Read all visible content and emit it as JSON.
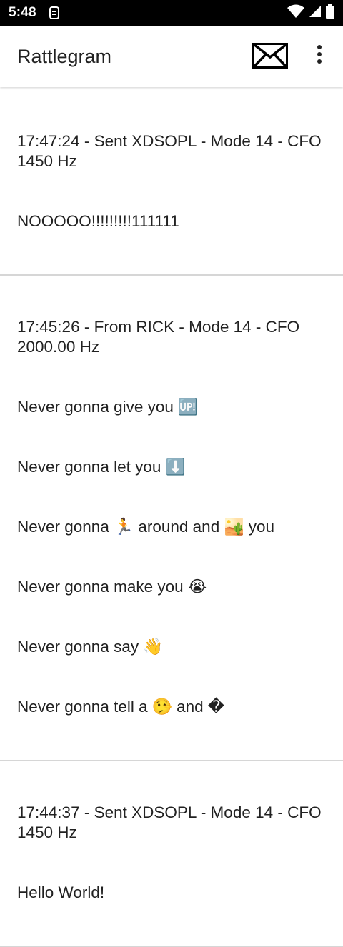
{
  "status_bar": {
    "time": "5:48",
    "app_icon": "sync-icon",
    "wifi_icon": "wifi-icon",
    "signal_icon": "signal-icon",
    "battery_icon": "battery-icon"
  },
  "app_bar": {
    "title": "Rattlegram",
    "mail_icon": "mail-icon",
    "overflow_icon": "more-vert-icon"
  },
  "messages": [
    {
      "header": "17:47:24 - Sent XDSOPL - Mode 14 - CFO 1450 Hz",
      "lines": [
        "NOOOOO!!!!!!!!!111111"
      ]
    },
    {
      "header": "17:45:26 - From RICK - Mode 14 - CFO 2000.00 Hz",
      "lines": [
        "Never gonna give you 🆙",
        "Never gonna let you ⬇️",
        "Never gonna 🏃 around and 🏜️ you",
        "Never gonna make you 😭",
        "Never gonna say 👋",
        "Never gonna tell a 🤥 and �"
      ]
    },
    {
      "header": "17:44:37 - Sent XDSOPL - Mode 14 - CFO 1450 Hz",
      "lines": [
        "Hello World!"
      ]
    }
  ]
}
